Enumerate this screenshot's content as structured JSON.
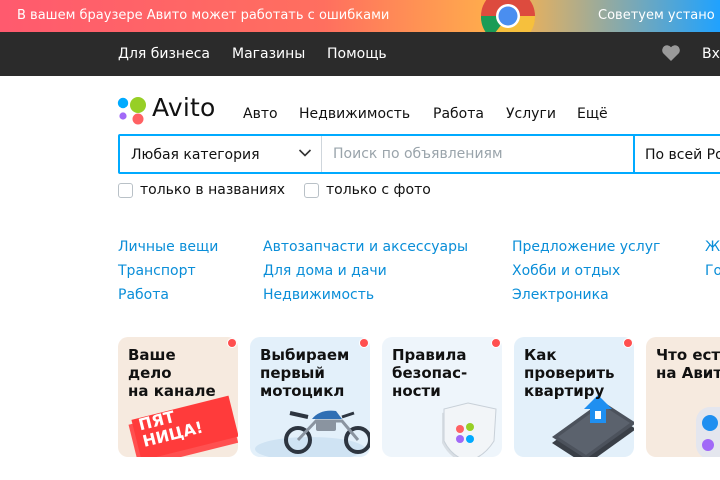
{
  "banner": {
    "message": "В вашем браузере Авито может работать с ошибками",
    "advice": "Советуем устано"
  },
  "topbar": {
    "links": [
      "Для бизнеса",
      "Магазины",
      "Помощь"
    ],
    "login": "Вх"
  },
  "header": {
    "logo": "Avito",
    "nav": [
      "Авто",
      "Недвижимость",
      "Работа",
      "Услуги",
      "Ещё"
    ]
  },
  "search": {
    "category": "Любая категория",
    "placeholder": "Поиск по объявлениям",
    "region": "По всей Ро",
    "options": [
      "только в названиях",
      "только с фото"
    ]
  },
  "categories": {
    "col1": [
      "Личные вещи",
      "Транспорт",
      "Работа"
    ],
    "col2": [
      "Автозапчасти и аксессуары",
      "Для дома и дачи",
      "Недвижимость"
    ],
    "col3": [
      "Предложение услуг",
      "Хобби и отдых",
      "Электроника"
    ],
    "col4": [
      "Ж",
      "Го"
    ]
  },
  "stories": [
    {
      "title": "Ваше\nдело\nна канале",
      "art_text": "ПЯТ\nНИЦА!",
      "unread": true
    },
    {
      "title": "Выбираем\nпервый\nмотоцикл",
      "unread": true
    },
    {
      "title": "Правила\nбезопас-\nности",
      "unread": true
    },
    {
      "title": "Как\nпроверить\nквартиру",
      "unread": true
    },
    {
      "title": "Что ест\nна Авит",
      "unread": false
    }
  ],
  "colors": {
    "accent": "#00aaff",
    "link": "#0a8ed8",
    "topbar": "#2b2b2b",
    "story_dot": "#ff4f4f"
  }
}
